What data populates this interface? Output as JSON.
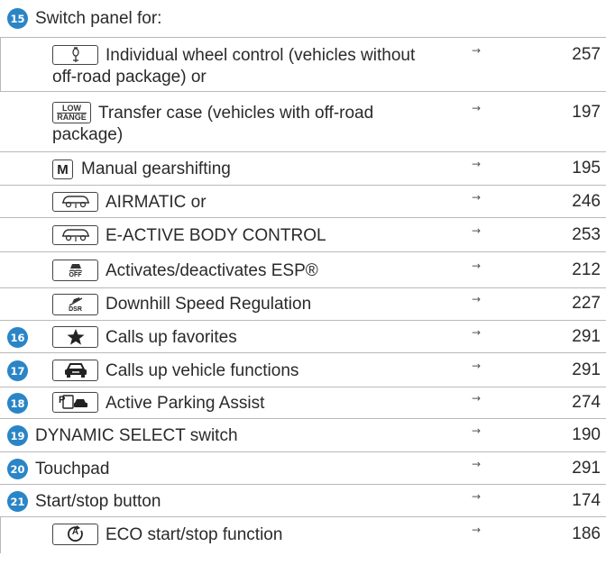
{
  "colors": {
    "badge": "#2a85c7",
    "rule": "#b9b9b9",
    "text": "#2a2a2a"
  },
  "arrow_symbol": "→",
  "rows": [
    {
      "num": "15",
      "text": "Switch panel for:",
      "page": ""
    },
    {
      "icon": "wheel-lift-icon",
      "text_line1": "Individual wheel control (vehicles without",
      "text_line2": "off-road package) or",
      "page": "257"
    },
    {
      "icon_text_top": "LOW",
      "icon_text_bottom": "RANGE",
      "text_line1": "Transfer case (vehicles with off-road",
      "text_line2": "package)",
      "page": "197"
    },
    {
      "icon_text": "M",
      "text": "Manual gearshifting",
      "page": "195"
    },
    {
      "icon": "suspension-icon",
      "text": "AIRMATIC or",
      "page": "246"
    },
    {
      "icon": "suspension-icon",
      "text": "E-ACTIVE BODY CONTROL",
      "page": "253"
    },
    {
      "icon": "esp-off-icon",
      "icon_text": "OFF",
      "text": "Activates/deactivates ESP®",
      "page": "212"
    },
    {
      "icon": "dsr-icon",
      "icon_text": "DSR",
      "text": "Downhill Speed Regulation",
      "page": "227"
    },
    {
      "num": "16",
      "icon": "star-icon",
      "text": "Calls up favorites",
      "page": "291"
    },
    {
      "num": "17",
      "icon": "car-icon",
      "text": "Calls up vehicle functions",
      "page": "291"
    },
    {
      "num": "18",
      "icon": "parking-camera-icon",
      "icon_text": "P",
      "text": "Active Parking Assist",
      "page": "274"
    },
    {
      "num": "19",
      "text": "DYNAMIC SELECT switch",
      "page": "190"
    },
    {
      "num": "20",
      "text": "Touchpad",
      "page": "291"
    },
    {
      "num": "21",
      "text": "Start/stop button",
      "page": "174"
    },
    {
      "icon": "eco-start-stop-icon",
      "icon_text": "A",
      "text": "ECO start/stop function",
      "page": "186"
    }
  ]
}
